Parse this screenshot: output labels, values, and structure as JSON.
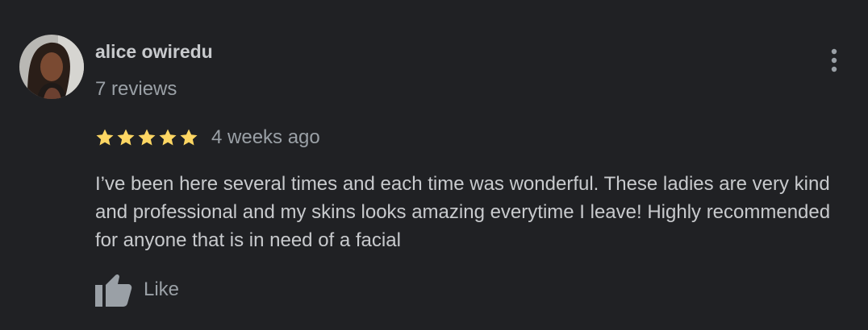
{
  "review": {
    "author_name": "alice owiredu",
    "review_count": "7 reviews",
    "rating": 5,
    "rating_max": 5,
    "time": "4 weeks ago",
    "text": "I’ve been here several times and each time was wonderful. These ladies are very kind and professional and my skins looks amazing everytime I leave! Highly recommended for anyone that is in need of a facial",
    "like_label": "Like"
  },
  "icons": {
    "more": "more-vert-icon",
    "like": "thumb-up-icon",
    "star": "star-icon"
  },
  "colors": {
    "background": "#202124",
    "text_primary": "#c8cacd",
    "text_secondary": "#9aa0a6",
    "star": "#fdd663"
  }
}
